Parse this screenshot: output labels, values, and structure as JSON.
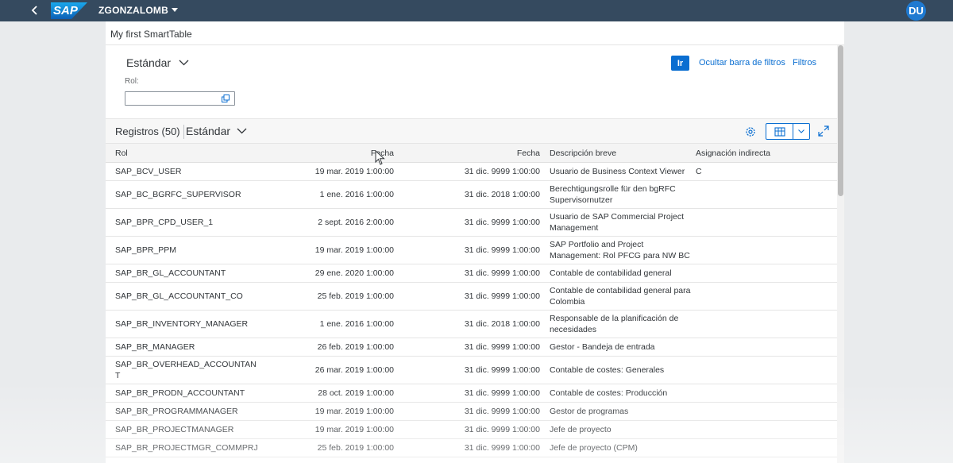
{
  "shell": {
    "logo_text": "SAP",
    "user_menu": "ZGONZALOMB",
    "avatar_initials": "DU",
    "colors": {
      "shellbar": "#354a5f",
      "accent": "#0a6ed1",
      "avatar": "#1f7ad1"
    }
  },
  "page": {
    "title": "My first SmartTable"
  },
  "filterbar": {
    "variant": "Estándar",
    "go_button": "Ir",
    "hide_filterbar": "Ocultar barra de filtros",
    "filters": "Filtros",
    "field_label": "Rol:",
    "field_value": ""
  },
  "table": {
    "count_label": "Registros (50)",
    "variant": "Estándar",
    "columns": [
      "Rol",
      "Fecha",
      "Fecha",
      "Descripción breve",
      "Asignación indirecta"
    ],
    "rows": [
      {
        "rol": "SAP_BCV_USER",
        "fecha1": "19 mar. 2019 1:00:00",
        "fecha2": "31 dic. 9999 1:00:00",
        "desc": "Usuario de Business Context Viewer",
        "asig": "C"
      },
      {
        "rol": "SAP_BC_BGRFC_SUPERVISOR",
        "fecha1": "1 ene. 2016 1:00:00",
        "fecha2": "31 dic. 2018 1:00:00",
        "desc": "Berechtigungsrolle für den bgRFC Supervisornutzer",
        "asig": ""
      },
      {
        "rol": "SAP_BPR_CPD_USER_1",
        "fecha1": "2 sept. 2016 2:00:00",
        "fecha2": "31 dic. 9999 1:00:00",
        "desc": "Usuario de SAP Commercial Project Management",
        "asig": ""
      },
      {
        "rol": "SAP_BPR_PPM",
        "fecha1": "19 mar. 2019 1:00:00",
        "fecha2": "31 dic. 9999 1:00:00",
        "desc": "SAP Portfolio and Project Management: Rol PFCG para NW BC",
        "asig": ""
      },
      {
        "rol": "SAP_BR_GL_ACCOUNTANT",
        "fecha1": "29 ene. 2020 1:00:00",
        "fecha2": "31 dic. 9999 1:00:00",
        "desc": "Contable de contabilidad general",
        "asig": ""
      },
      {
        "rol": "SAP_BR_GL_ACCOUNTANT_CO",
        "fecha1": "25 feb. 2019 1:00:00",
        "fecha2": "31 dic. 9999 1:00:00",
        "desc": "Contable de contabilidad general para Colombia",
        "asig": ""
      },
      {
        "rol": "SAP_BR_INVENTORY_MANAGER",
        "fecha1": "1 ene. 2016 1:00:00",
        "fecha2": "31 dic. 2018 1:00:00",
        "desc": "Responsable de la planificación de necesidades",
        "asig": ""
      },
      {
        "rol": "SAP_BR_MANAGER",
        "fecha1": "26 feb. 2019 1:00:00",
        "fecha2": "31 dic. 9999 1:00:00",
        "desc": "Gestor - Bandeja de entrada",
        "asig": ""
      },
      {
        "rol": "SAP_BR_OVERHEAD_ACCOUNTAN T",
        "fecha1": "26 mar. 2019 1:00:00",
        "fecha2": "31 dic. 9999 1:00:00",
        "desc": "Contable de costes: Generales",
        "asig": ""
      },
      {
        "rol": "SAP_BR_PRODN_ACCOUNTANT",
        "fecha1": "28 oct. 2019 1:00:00",
        "fecha2": "31 dic. 9999 1:00:00",
        "desc": "Contable de costes: Producción",
        "asig": ""
      },
      {
        "rol": "SAP_BR_PROGRAMMANAGER",
        "fecha1": "19 mar. 2019 1:00:00",
        "fecha2": "31 dic. 9999 1:00:00",
        "desc": "Gestor de programas",
        "asig": ""
      },
      {
        "rol": "SAP_BR_PROJECTMANAGER",
        "fecha1": "19 mar. 2019 1:00:00",
        "fecha2": "31 dic. 9999 1:00:00",
        "desc": "Jefe de proyecto",
        "asig": ""
      },
      {
        "rol": "SAP_BR_PROJECTMGR_COMMPRJ",
        "fecha1": "25 feb. 2019 1:00:00",
        "fecha2": "31 dic. 9999 1:00:00",
        "desc": "Jefe de proyecto (CPM)",
        "asig": ""
      }
    ]
  }
}
